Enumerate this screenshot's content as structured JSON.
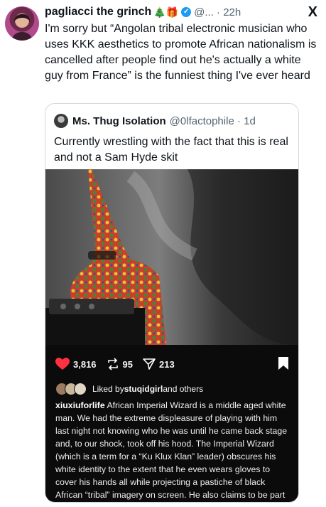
{
  "tweet": {
    "author_name": "pagliacci the grinch",
    "author_emojis": "🎄🎁",
    "handle_time": "@... · 22h",
    "platform_icon": "X",
    "text": "I'm sorry but “Angolan tribal electronic musician who uses KKK aesthetics to promote African nationalism is cancelled after people find out he's actually a white guy from France” is the funniest thing I've ever heard"
  },
  "quote": {
    "author_name": "Ms. Thug Isolation",
    "handle_time": "@0lfactophile · 1d",
    "text": "Currently wrestling with the fact that this is real and not a Sam Hyde skit"
  },
  "instagram": {
    "likes_count": "3,816",
    "reposts_count": "95",
    "shares_count": "213",
    "liked_by_prefix": "Liked by ",
    "liked_by_user": "stuqidgirl",
    "liked_by_suffix": " and others",
    "caption_user": "xiuxiuforlife",
    "caption_text": " African Imperial Wizard is a middle aged white man. We had the extreme displeasure of playing with him last night not knowing who he was until he came back stage and, to our shock, took off his hood. The Imperial Wizard (which is a term for a “Ku Klux Klan” leader) obscures his white identity to the extent that he even wears gloves to cover his hands all while projecting a pastiche of black African “tribal” imagery on screen. He also claims to be part of an imagined pan"
  },
  "colors": {
    "verified": "#1d9bf0",
    "like_heart": "#ff3040",
    "muted_text": "#536471",
    "ig_background": "#0b0b0b"
  }
}
